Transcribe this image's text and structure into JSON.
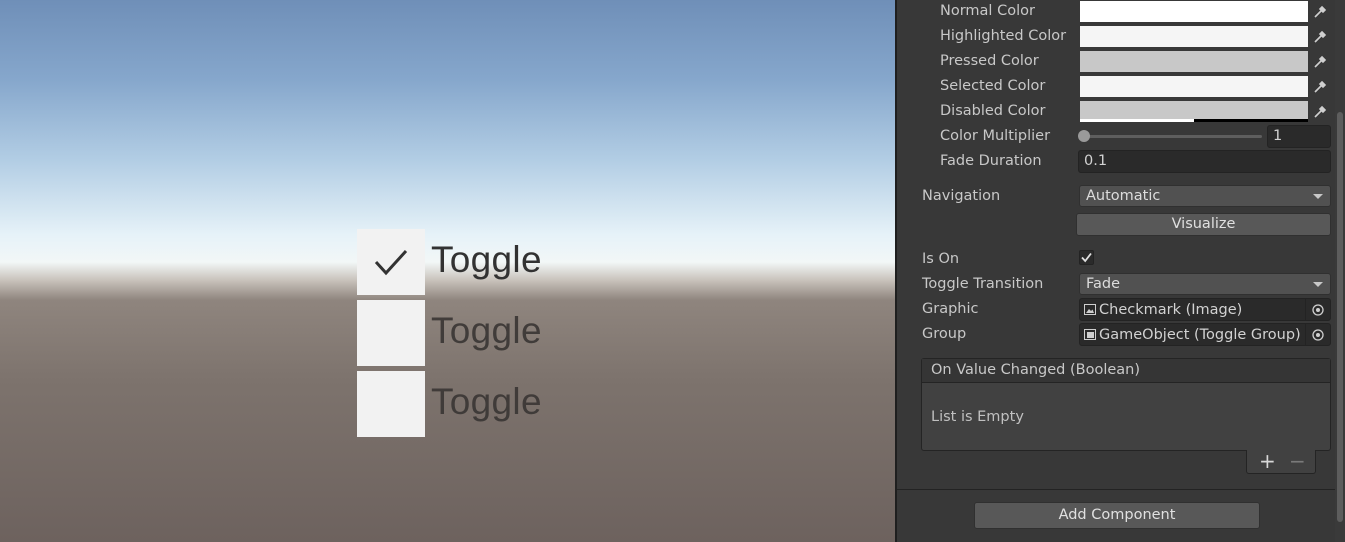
{
  "scene": {
    "toggles": [
      {
        "label": "Toggle",
        "checked": true
      },
      {
        "label": "Toggle",
        "checked": false
      },
      {
        "label": "Toggle",
        "checked": false
      }
    ]
  },
  "inspector": {
    "colors": {
      "normal_label": "Normal Color",
      "highlighted_label": "Highlighted Color",
      "pressed_label": "Pressed Color",
      "selected_label": "Selected Color",
      "disabled_label": "Disabled Color",
      "normal_value": "#ffffff",
      "highlighted_value": "#f5f5f5",
      "pressed_value": "#c8c8c8",
      "selected_value": "#f5f5f5",
      "disabled_value": "#c8c8c8"
    },
    "color_multiplier": {
      "label": "Color Multiplier",
      "value": "1",
      "level": 0.0
    },
    "fade_duration": {
      "label": "Fade Duration",
      "value": "0.1"
    },
    "navigation": {
      "label": "Navigation",
      "value": "Automatic",
      "visualize_label": "Visualize"
    },
    "is_on": {
      "label": "Is On",
      "checked": true
    },
    "toggle_transition": {
      "label": "Toggle Transition",
      "value": "Fade"
    },
    "graphic": {
      "label": "Graphic",
      "value": "Checkmark (Image)"
    },
    "group": {
      "label": "Group",
      "value": "GameObject (Toggle Group)"
    },
    "events": {
      "header": "On Value Changed (Boolean)",
      "empty_text": "List is Empty",
      "add_symbol": "+",
      "remove_symbol": "−"
    },
    "add_component_label": "Add Component"
  }
}
